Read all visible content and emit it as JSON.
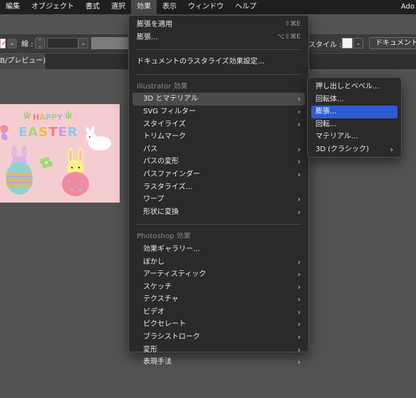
{
  "menubar": {
    "items": [
      "編集",
      "オブジェクト",
      "書式",
      "選択",
      "効果",
      "表示",
      "ウィンドウ",
      "ヘルプ"
    ],
    "active_index": 4,
    "right_text": "Ado"
  },
  "controlbar": {
    "stroke_label": "線 :",
    "style_label": "スタイル :",
    "document_button": "ドキュメント設"
  },
  "tab": {
    "label": "B/プレビュー)"
  },
  "artboard": {
    "title_happy": "HAPPY",
    "title_easter": "EASTER",
    "colors": {
      "background": "#f5cdd1",
      "egg_left": "#8fd1cf",
      "egg_right": "#f08aa0",
      "bunny_yellow": "#fbf08a",
      "bunny_purple": "#d7b3ee"
    }
  },
  "effects_menu": {
    "apply": {
      "label": "膨張を適用",
      "shortcut": "⇧⌘E"
    },
    "last": {
      "label": "膨張...",
      "shortcut": "⌥⇧⌘E"
    },
    "raster_settings": "ドキュメントのラスタライズ効果設定...",
    "illustrator_header": "Illustrator 効果",
    "illustrator_items": [
      {
        "label": "3D とマテリアル",
        "submenu": true
      },
      {
        "label": "SVG フィルター",
        "submenu": true
      },
      {
        "label": "スタイライズ",
        "submenu": true
      },
      {
        "label": "トリムマーク",
        "submenu": false
      },
      {
        "label": "パス",
        "submenu": true
      },
      {
        "label": "パスの変形",
        "submenu": true
      },
      {
        "label": "パスファインダー",
        "submenu": true
      },
      {
        "label": "ラスタライズ...",
        "submenu": false
      },
      {
        "label": "ワープ",
        "submenu": true
      },
      {
        "label": "形状に変換",
        "submenu": true
      }
    ],
    "photoshop_header": "Photoshop 効果",
    "photoshop_items": [
      {
        "label": "効果ギャラリー...",
        "submenu": false
      },
      {
        "label": "ぼかし",
        "submenu": true
      },
      {
        "label": "アーティスティック",
        "submenu": true
      },
      {
        "label": "スケッチ",
        "submenu": true
      },
      {
        "label": "テクスチャ",
        "submenu": true
      },
      {
        "label": "ビデオ",
        "submenu": true
      },
      {
        "label": "ピクセレート",
        "submenu": true
      },
      {
        "label": "ブラシストローク",
        "submenu": true
      },
      {
        "label": "変形",
        "submenu": true
      },
      {
        "label": "表現手法",
        "submenu": true
      }
    ]
  },
  "submenu_3d": {
    "items": [
      {
        "label": "押し出しとベベル...",
        "submenu": false
      },
      {
        "label": "回転体...",
        "submenu": false
      },
      {
        "label": "膨張...",
        "submenu": false
      },
      {
        "label": "回転...",
        "submenu": false
      },
      {
        "label": "マテリアル...",
        "submenu": false
      },
      {
        "label": "3D (クラシック)",
        "submenu": true
      }
    ],
    "highlighted_index": 2
  },
  "colors": {
    "highlight": "#2e5bd3",
    "menu_bg": "#2a2a2a",
    "workspace": "#535353"
  }
}
